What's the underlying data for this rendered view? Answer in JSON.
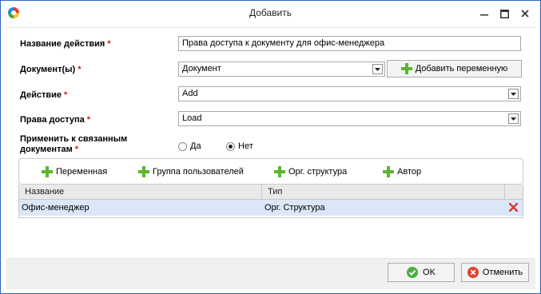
{
  "window": {
    "title": "Добавить"
  },
  "form": {
    "action_name": {
      "label": "Название действия",
      "value": "Права доступа к документу для офис-менеджера"
    },
    "documents": {
      "label": "Документ(ы)",
      "value": "Документ",
      "add_variable_label": "Добавить переменную"
    },
    "action": {
      "label": "Действие",
      "value": "Add"
    },
    "access_rights": {
      "label": "Права доступа",
      "value": "Load"
    },
    "apply_linked": {
      "label_line1": "Применить к связанным",
      "label_line2": "документам",
      "option_yes": "Да",
      "option_no": "Нет",
      "selected": "Нет"
    },
    "required_mark": "*"
  },
  "toolbar": {
    "items": [
      "Переменная",
      "Группа пользователей",
      "Орг. структура",
      "Автор"
    ]
  },
  "table": {
    "columns": [
      "Название",
      "Тип"
    ],
    "rows": [
      {
        "name": "Офис-менеджер",
        "type": "Орг. Структура"
      }
    ]
  },
  "footer": {
    "ok_label": "OK",
    "cancel_label": "Отменить"
  },
  "colors": {
    "required": "#d21d1d",
    "plus": "#5cb531",
    "selected_row": "#dbe7f8",
    "delete": "#d63a2f",
    "ok": "#4caf3f",
    "cancel": "#e0442d"
  }
}
